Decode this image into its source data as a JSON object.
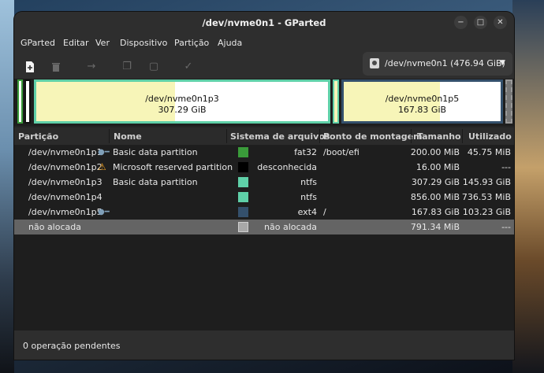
{
  "window": {
    "title": "/dev/nvme0n1 - GParted"
  },
  "menu": [
    "GParted",
    "Editar",
    "Ver",
    "Dispositivo",
    "Partição",
    "Ajuda"
  ],
  "toolbar": {
    "new_icon": "new-partition-icon",
    "delete_icon": "delete-icon",
    "resize_icon": "resize-move-icon",
    "copy_icon": "copy-icon",
    "paste_icon": "paste-icon",
    "apply_icon": "apply-checkmark-icon"
  },
  "device": {
    "label": "/dev/nvme0n1 (476.94 GiB)"
  },
  "visual": {
    "p3": {
      "name": "/dev/nvme0n1p3",
      "size": "307.29 GiB"
    },
    "p5": {
      "name": "/dev/nvme0n1p5",
      "size": "167.83 GiB"
    }
  },
  "columns": [
    "Partição",
    "Nome",
    "Sistema de arquivos",
    "Ponto de montagem",
    "Tamanho",
    "Utilizado"
  ],
  "rows": [
    {
      "partition": "/dev/nvme0n1p1",
      "name": "Basic data partition",
      "fs": "fat32",
      "fs_color": "#3a9b3a",
      "mount": "/boot/efi",
      "size": "200.00 MiB",
      "used": "45.75 MiB",
      "icon": "key"
    },
    {
      "partition": "/dev/nvme0n1p2",
      "name": "Microsoft reserved partition",
      "fs": "desconhecida",
      "fs_color": "#000000",
      "mount": "",
      "size": "16.00 MiB",
      "used": "---",
      "icon": "warning"
    },
    {
      "partition": "/dev/nvme0n1p3",
      "name": "Basic data partition",
      "fs": "ntfs",
      "fs_color": "#5fd0a8",
      "mount": "",
      "size": "307.29 GiB",
      "used": "145.93 GiB",
      "icon": ""
    },
    {
      "partition": "/dev/nvme0n1p4",
      "name": "",
      "fs": "ntfs",
      "fs_color": "#5fd0a8",
      "mount": "",
      "size": "856.00 MiB",
      "used": "736.53 MiB",
      "icon": ""
    },
    {
      "partition": "/dev/nvme0n1p5",
      "name": "",
      "fs": "ext4",
      "fs_color": "#34506c",
      "mount": "/",
      "size": "167.83 GiB",
      "used": "103.23 GiB",
      "icon": "key"
    },
    {
      "partition": "não alocada",
      "name": "",
      "fs": "não alocada",
      "fs_color": "#a8a8a8",
      "mount": "",
      "size": "791.34 MiB",
      "used": "---",
      "icon": ""
    }
  ],
  "status": {
    "text": "0 operação pendentes"
  }
}
